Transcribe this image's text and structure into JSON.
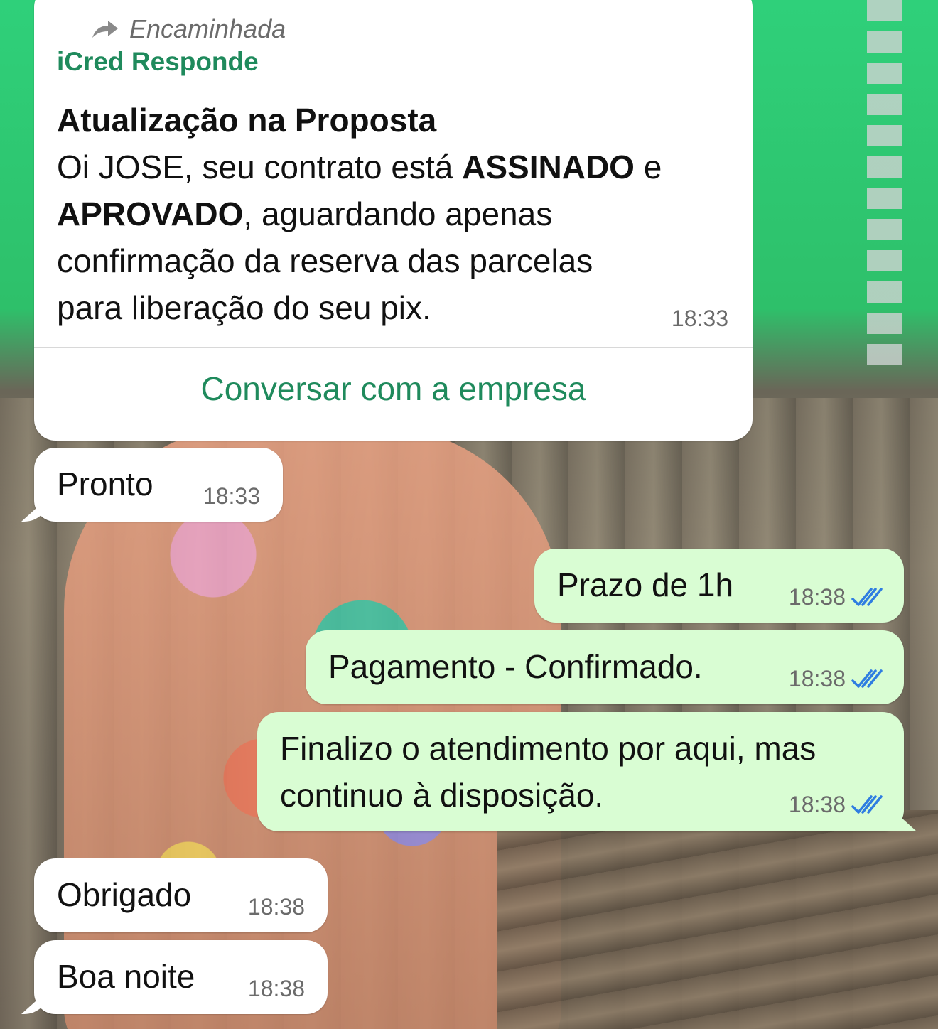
{
  "chat": {
    "card": {
      "forwarded_label": "Encaminhada",
      "sender": "iCred Responde",
      "title": "Atualização na Proposta",
      "body": {
        "l1_a": "Oi JOSE, seu contrato está ",
        "l1_b": "ASSINADO",
        "l1_c": " e",
        "l2_a": "APROVADO",
        "l2_b": ", aguardando apenas",
        "l3": "confirmação da reserva das parcelas",
        "l4": "para liberação do seu pix."
      },
      "time": "18:33",
      "action_label": "Conversar com a empresa"
    },
    "messages": [
      {
        "text": "Pronto",
        "time": "18:33"
      },
      {
        "text": "Prazo de 1h",
        "time": "18:38"
      },
      {
        "text": "Pagamento - Confirmado.",
        "time": "18:38"
      },
      {
        "line1": "Finalizo o atendimento por aqui, mas",
        "line2": "continuo à disposição.",
        "time": "18:38"
      },
      {
        "text": "Obrigado",
        "time": "18:38"
      },
      {
        "text": "Boa noite",
        "time": "18:38"
      }
    ],
    "colors": {
      "incoming_bubble": "#ffffff",
      "outgoing_bubble": "#d9fdd3",
      "accent_green": "#1f8a5c",
      "read_ticks": "#2f7de1"
    }
  }
}
